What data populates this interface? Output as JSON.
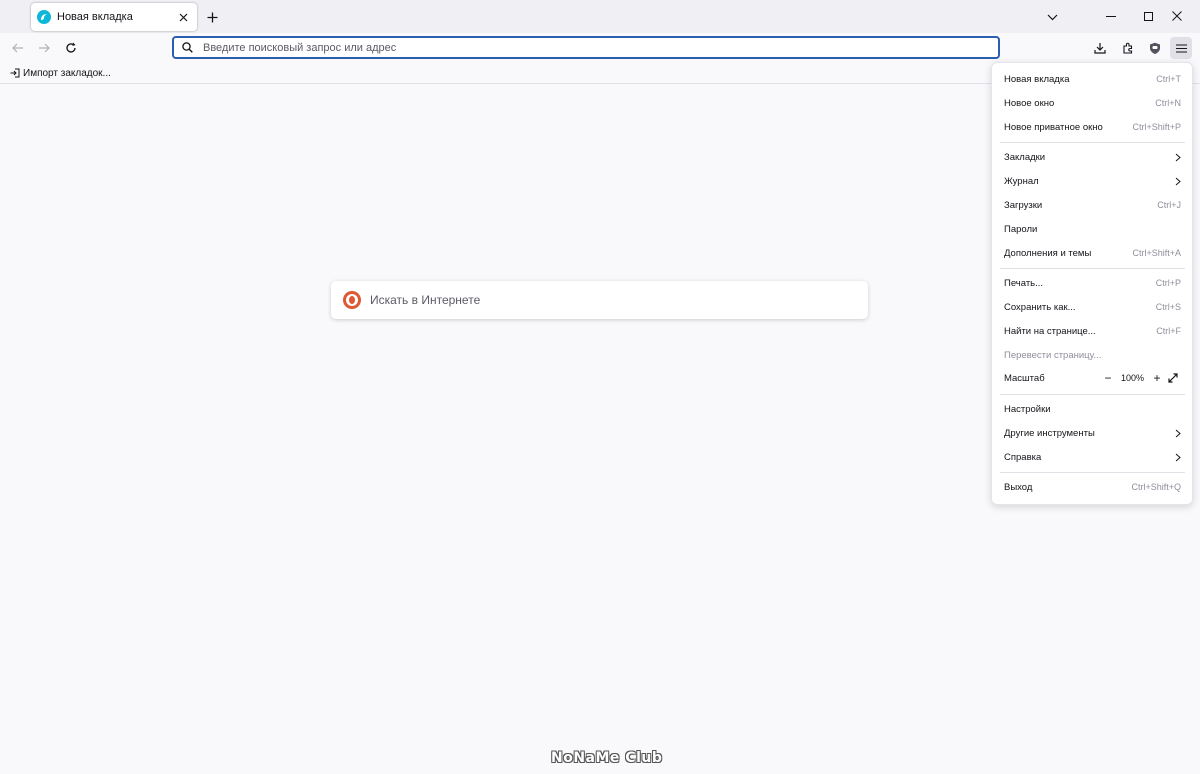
{
  "tab": {
    "title": "Новая вкладка",
    "favicon": "firefox-icon"
  },
  "toolbar": {
    "url_placeholder": "Введите поисковый запрос или адрес",
    "accent": "#2a5fb0"
  },
  "bookmarks": [
    {
      "label": "Импорт закладок..."
    }
  ],
  "content": {
    "search_placeholder": "Искать в Интернете",
    "search_engine_icon": "duckduckgo-icon"
  },
  "app_menu": {
    "items": [
      {
        "id": "new-tab",
        "label": "Новая вкладка",
        "shortcut": "Ctrl+T"
      },
      {
        "id": "new-window",
        "label": "Новое окно",
        "shortcut": "Ctrl+N"
      },
      {
        "id": "new-private",
        "label": "Новое приватное окно",
        "shortcut": "Ctrl+Shift+P"
      },
      {
        "id": "bookmarks",
        "label": "Закладки",
        "shortcut": ""
      },
      {
        "id": "history",
        "label": "Журнал",
        "shortcut": ""
      },
      {
        "id": "downloads",
        "label": "Загрузки",
        "shortcut": "Ctrl+J"
      },
      {
        "id": "passwords",
        "label": "Пароли",
        "shortcut": ""
      },
      {
        "id": "addons",
        "label": "Дополнения и темы",
        "shortcut": "Ctrl+Shift+A"
      },
      {
        "id": "print",
        "label": "Печать...",
        "shortcut": "Ctrl+P"
      },
      {
        "id": "save-as",
        "label": "Сохранить как...",
        "shortcut": "Ctrl+S"
      },
      {
        "id": "find",
        "label": "Найти на странице...",
        "shortcut": "Ctrl+F"
      },
      {
        "id": "translate",
        "label": "Перевести страницу...",
        "shortcut": ""
      },
      {
        "id": "zoom",
        "label": "Масштаб",
        "shortcut": ""
      },
      {
        "id": "settings",
        "label": "Настройки",
        "shortcut": ""
      },
      {
        "id": "more-tools",
        "label": "Другие инструменты",
        "shortcut": ""
      },
      {
        "id": "help",
        "label": "Справка",
        "shortcut": ""
      },
      {
        "id": "exit",
        "label": "Выход",
        "shortcut": "Ctrl+Shift+Q"
      }
    ],
    "zoom": {
      "minus": "−",
      "value": "100%",
      "plus": "+"
    }
  },
  "watermark": "NoNaMe Club"
}
